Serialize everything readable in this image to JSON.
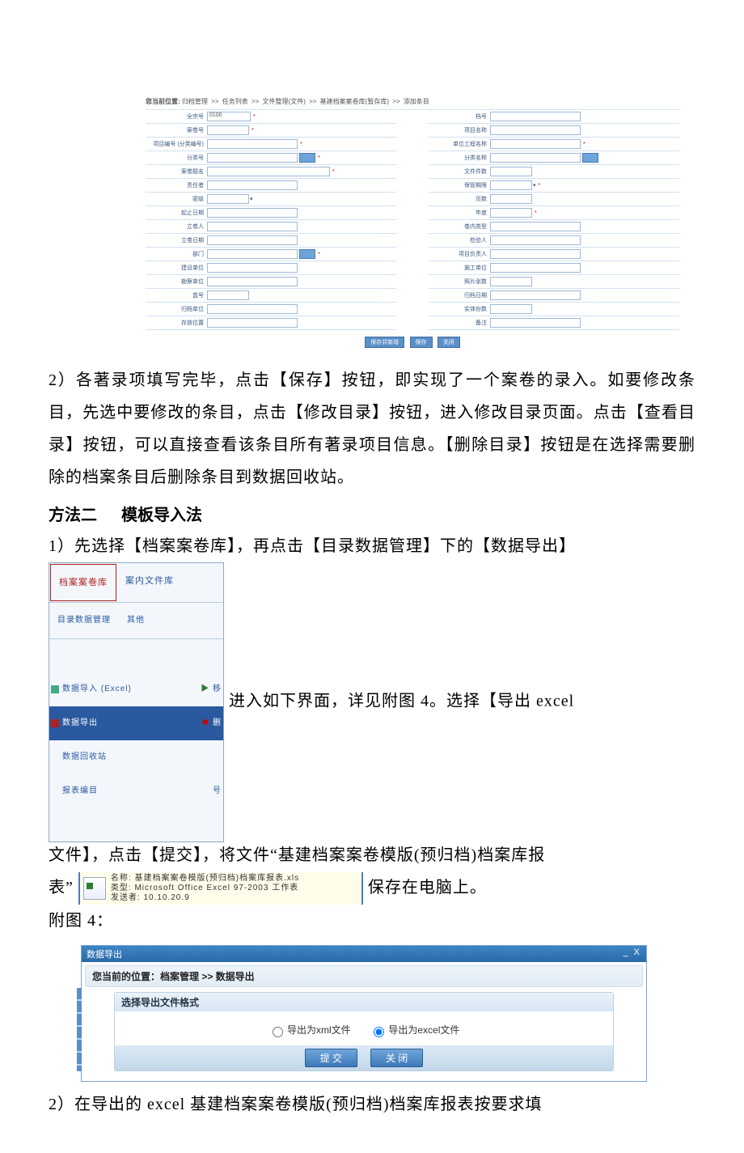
{
  "form": {
    "breadcrumb": [
      "您当前位置:",
      "归档管理",
      ">>",
      "任务列表",
      ">>",
      "文件整理(文件)",
      ">>",
      "基建档案案卷库(暂存库)",
      ">>",
      "添加条目"
    ],
    "left": [
      {
        "label": "全宗号",
        "value": "0100",
        "req": true,
        "w": "w-short"
      },
      {
        "label": "案卷号",
        "req": true,
        "w": "w-short"
      },
      {
        "label": "项目编号 (分类编号)",
        "req": true,
        "w": "w-med"
      },
      {
        "label": "分类号",
        "req": true,
        "w": "w-med",
        "pick": true
      },
      {
        "label": "案卷题名",
        "req": true,
        "w": "w-long"
      },
      {
        "label": "责任者",
        "w": "w-med"
      },
      {
        "label": "密级",
        "w": "w-short",
        "drop": true
      },
      {
        "label": "起止日期",
        "w": "w-med"
      },
      {
        "label": "立卷人",
        "w": "w-med"
      },
      {
        "label": "立卷日期",
        "w": "w-med"
      },
      {
        "label": "部门",
        "req": true,
        "w": "w-med",
        "pick": true
      },
      {
        "label": "建设单位",
        "w": "w-med"
      },
      {
        "label": "勘察单位",
        "w": "w-med"
      },
      {
        "label": "盒号",
        "w": "w-short"
      },
      {
        "label": "归档单位",
        "w": "w-med"
      },
      {
        "label": "存放位置",
        "w": "w-med"
      }
    ],
    "right": [
      {
        "label": "档号",
        "w": "w-med"
      },
      {
        "label": "项目名称",
        "w": "w-med"
      },
      {
        "label": "单位工程名称",
        "req": true,
        "w": "w-med"
      },
      {
        "label": "分类名称",
        "w": "w-med",
        "pick": true
      },
      {
        "label": "文件件数",
        "w": "w-short"
      },
      {
        "label": "保管期限",
        "drop": true,
        "req": true,
        "w": "w-short"
      },
      {
        "label": "页数",
        "w": "w-short"
      },
      {
        "label": "年度",
        "req": true,
        "w": "w-short"
      },
      {
        "label": "卷内类型",
        "w": "w-med"
      },
      {
        "label": "检验人",
        "w": "w-med"
      },
      {
        "label": "项目负责人",
        "w": "w-med"
      },
      {
        "label": "施工单位",
        "w": "w-med"
      },
      {
        "label": "照片张数",
        "w": "w-short"
      },
      {
        "label": "归档日期",
        "w": "w-med"
      },
      {
        "label": "实体份数",
        "w": "w-short"
      },
      {
        "label": "备注",
        "w": "w-med"
      }
    ],
    "buttons": [
      "保存并新增",
      "保存",
      "关闭"
    ]
  },
  "body": {
    "p1": "2）各著录项填写完毕，点击【保存】按钮，即实现了一个案卷的录入。如要修改条目，先选中要修改的条目，点击【修改目录】按钮，进入修改目录页面。点击【查看目录】按钮，可以直接查看该条目所有著录项目信息。【删除目录】按钮是在选择需要删除的档案条目后删除条目到数据回收站。",
    "h2a": "方法二",
    "h2b": "模板导入法",
    "p2_lead": "1）先选择【档案案卷库】，再点击【目录数据管理】下的【数据导出】",
    "p2_mid": "进入如下界面，详见附图 4。选择【导出 excel",
    "p2_mid2": "文件】，点击【提交】，将文件“基建档案案卷模版(预归档)档案库报",
    "p2_tail_a": "表”",
    "p2_tail_b": "保存在电脑上。",
    "fig4": "附图 4：",
    "p3": "2）在导出的 excel 基建档案案卷模版(预归档)档案库报表按要求填"
  },
  "menu": {
    "tab_active": "档案案卷库",
    "tab_other": "案内文件库",
    "sub1": "目录数据管理",
    "sub2": "其他",
    "items": [
      {
        "icon": "import",
        "label": "数据导入 (Excel)",
        "trail": "移"
      },
      {
        "icon": "export",
        "label": "数据导出",
        "sel": true,
        "trail": "删"
      },
      {
        "icon": "",
        "label": "数据回收站",
        "trail": ""
      },
      {
        "icon": "",
        "label": "报表编目",
        "trail": "号"
      }
    ]
  },
  "filebar": {
    "l1": "名称:  基建档案案卷模版(预归档)档案库报表.xls",
    "l2": "类型:  Microsoft Office Excel 97-2003 工作表",
    "l3": "发送者: 10.10.20.9"
  },
  "dialog": {
    "title": "数据导出",
    "wx": "_  X",
    "crumb": "您当前的位置：档案管理 >> 数据导出",
    "panel_head": "选择导出文件格式",
    "opt_xml": "导出为xml文件",
    "opt_excel": "导出为excel文件",
    "btn_submit": "提  交",
    "btn_close": "关  闭"
  }
}
